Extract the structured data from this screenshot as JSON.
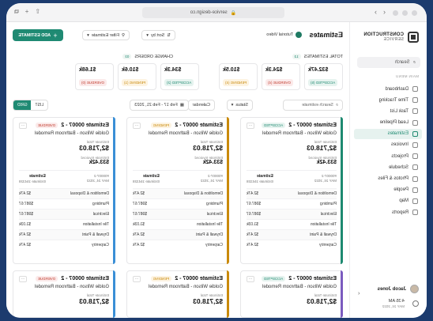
{
  "browser": {
    "url": "service-design.co",
    "nav_back": "‹",
    "nav_fwd": "›",
    "share": "⇧",
    "new_tab": "+",
    "tabs_icon": "⧉"
  },
  "sidebar": {
    "logo_line1": "CONSTRUCTION",
    "logo_line2": "SERVICE",
    "search_label": "Search",
    "section_label": "MAIN MENU",
    "items": [
      {
        "label": "Dashboard",
        "icon": "home-icon"
      },
      {
        "label": "Time Tracking",
        "icon": "clock-icon"
      },
      {
        "label": "Task List",
        "icon": "checklist-icon"
      },
      {
        "label": "Lead Pipeline",
        "icon": "funnel-icon"
      },
      {
        "label": "Estimates",
        "icon": "document-icon",
        "active": true
      },
      {
        "label": "Invoices",
        "icon": "receipt-icon"
      },
      {
        "label": "Projects",
        "icon": "folder-icon"
      },
      {
        "label": "Schedule",
        "icon": "calendar-icon"
      },
      {
        "label": "Photos & Files",
        "icon": "image-icon"
      },
      {
        "label": "People",
        "icon": "people-icon"
      },
      {
        "label": "Map",
        "icon": "map-icon"
      },
      {
        "label": "Reports",
        "icon": "chart-icon"
      }
    ],
    "user_name": "Jacob Jones",
    "clock_time": "4:35 AM",
    "clock_date": "MAY 24, 2022",
    "collapse_icon": "‹"
  },
  "header": {
    "title": "Estimates",
    "tutorial": "Tutorial Video",
    "sort_by": "Sort by",
    "filter_estimate": "Filter Estimate",
    "add_estimate": "ADD ESTIMATE"
  },
  "summary": {
    "total_label": "TOTAL ESTIMATES",
    "total_count": "13",
    "change_label": "CHANGE ORDERS",
    "change_count": "03",
    "cards": [
      {
        "value": "$32.47k",
        "tag": "ACCEPTED (5)",
        "color": "#1e8a71",
        "bg": "#e6f3ef"
      },
      {
        "value": "$24.3k",
        "tag": "OVERDUE (4)",
        "color": "#c0392b",
        "bg": "#fbeaea"
      },
      {
        "value": "$10.5k",
        "tag": "PENDING (4)",
        "color": "#c98a0b",
        "bg": "#fdf3e1"
      },
      {
        "value": "$34.3k",
        "tag": "ACCEPTED (2)",
        "color": "#1e8a71",
        "bg": "#e6f3ef"
      },
      {
        "value": "$10.6k",
        "tag": "PENDING (1)",
        "color": "#c98a0b",
        "bg": "#fdf3e1"
      },
      {
        "value": "$1.68k",
        "tag": "OVERDUE (0)",
        "color": "#c0392b",
        "bg": "#fbeaea"
      }
    ]
  },
  "filters": {
    "search_placeholder": "Search estimate",
    "status": "Status",
    "date_range": "Feb 17 - Feb 21, 2023",
    "calendar": "Calendar",
    "list": "LIST",
    "grid": "GRID"
  },
  "cards": [
    {
      "title": "Estimate 00007 - 2",
      "status": "ACCEPTED",
      "status_color": "#1e8a71",
      "status_bg": "#e6f3ef",
      "stripe": "#1e8a71",
      "client": "Goldie Wilson - Bathroom Remodel",
      "total_label": "Estimate Total",
      "total": "$2,718.03",
      "invoiced_label": "Estimate Invoiced",
      "invoiced": "$33.42k",
      "code": "#00007-2",
      "date": "MAY 24, 2022",
      "est_label": "Estimate",
      "est_val": "Estimate 154328",
      "rows": [
        [
          "Demolition & Disposal",
          "$2.47k"
        ],
        [
          "Plumbing",
          "$987.67"
        ],
        [
          "Electrical",
          "$987.67"
        ],
        [
          "Tile Installation",
          "$1.03k"
        ],
        [
          "Drywall & Paint",
          "$2.47k"
        ],
        [
          "Carpentry",
          "$2.47k"
        ]
      ]
    },
    {
      "title": "Estimate 00007 - 2",
      "status": "PENDING",
      "status_color": "#c98a0b",
      "status_bg": "#fdf3e1",
      "stripe": "#c98a0b",
      "client": "Goldie Wilson - Bathroom Remodel",
      "total_label": "Estimate Total",
      "total": "$2,718.03",
      "invoiced_label": "Estimate Invoiced",
      "invoiced": "$33.42k",
      "code": "#00007-2",
      "date": "MAY 24, 2022",
      "est_label": "Estimate",
      "est_val": "Estimate 154328",
      "rows": [
        [
          "Demolition & Disposal",
          "$2.47k"
        ],
        [
          "Plumbing",
          "$987.67"
        ],
        [
          "Electrical",
          "$987.67"
        ],
        [
          "Tile Installation",
          "$1.03k"
        ],
        [
          "Drywall & Paint",
          "$2.47k"
        ],
        [
          "Carpentry",
          "$2.47k"
        ]
      ]
    },
    {
      "title": "Estimate 00007 - 2",
      "status": "OVERDUE",
      "status_color": "#c0392b",
      "status_bg": "#fbeaea",
      "stripe": "#3a8fd6",
      "client": "Goldie Wilson - Bathroom Remodel",
      "total_label": "Estimate Total",
      "total": "$2,718.03",
      "invoiced_label": "Estimate Invoiced",
      "invoiced": "$33.42k",
      "code": "#00007-2",
      "date": "MAY 24, 2022",
      "est_label": "Estimate",
      "est_val": "Estimate 154328",
      "rows": [
        [
          "Demolition & Disposal",
          "$2.47k"
        ],
        [
          "Plumbing",
          "$987.67"
        ],
        [
          "Electrical",
          "$987.67"
        ],
        [
          "Tile Installation",
          "$1.03k"
        ],
        [
          "Drywall & Paint",
          "$2.47k"
        ],
        [
          "Carpentry",
          "$2.47k"
        ]
      ]
    },
    {
      "title": "Estimate 00007 - 2",
      "status": "ACCEPTED",
      "status_color": "#1e8a71",
      "status_bg": "#e6f3ef",
      "stripe": "#7b5bbf",
      "client": "Goldie Wilson - Bathroom Remodel",
      "total_label": "Estimate Total",
      "total": "$2,718.03"
    },
    {
      "title": "Estimate 00007 - 2",
      "status": "PENDING",
      "status_color": "#c98a0b",
      "status_bg": "#fdf3e1",
      "stripe": "#c98a0b",
      "client": "Goldie Wilson - Bathroom Remodel",
      "total_label": "Estimate Total",
      "total": "$2,718.03"
    },
    {
      "title": "Estimate 00007 - 2",
      "status": "OVERDUE",
      "status_color": "#c0392b",
      "status_bg": "#fbeaea",
      "stripe": "#3a8fd6",
      "client": "Goldie Wilson - Bathroom Remodel",
      "total_label": "Estimate Total",
      "total": "$2,718.03"
    }
  ]
}
